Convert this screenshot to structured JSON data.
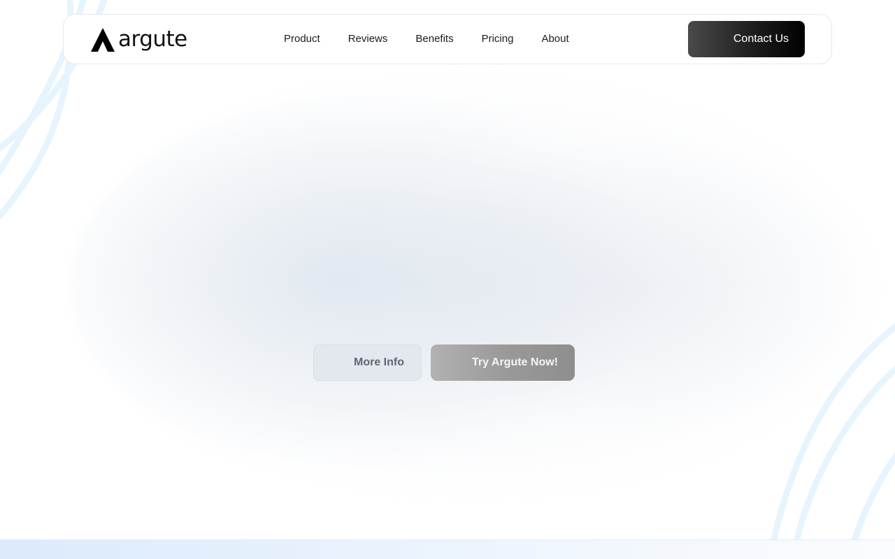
{
  "brand": {
    "name": "argute",
    "logo_icon": "argute-a-icon"
  },
  "nav": {
    "links": [
      "Product",
      "Reviews",
      "Benefits",
      "Pricing",
      "About"
    ],
    "contact_label": "Contact Us"
  },
  "hero": {
    "more_info_label": "More Info",
    "try_label": "Try Argute Now!"
  },
  "colors": {
    "accent_dark": "#000000",
    "decor_arcs": "#e6f4fd",
    "secondary_button_bg": "#e3e8ef",
    "primary_button_bg": "#9a9a9a"
  }
}
